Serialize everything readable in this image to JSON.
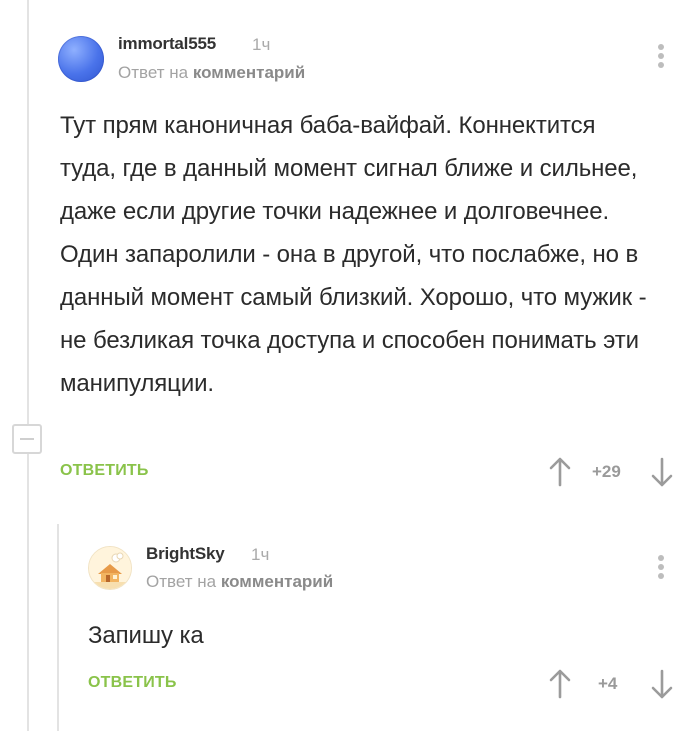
{
  "comments": [
    {
      "username": "immortal555",
      "time": "1ч",
      "reply_prefix": "Ответ на",
      "reply_target": "комментарий",
      "text": "Тут прям каноничная баба-вайфай. Коннектится туда, где в данный момент сигнал ближе и сильнее, даже если другие точки надежнее и долговечнее. Один запаролили - она в другой, что послабже, но в данный момент самый близкий. Хорошо, что мужик - не безликая точка доступа и способен понимать эти манипуляции.",
      "reply_label": "ОТВЕТИТЬ",
      "rating": "+29",
      "avatar_icon": "blue-sphere-avatar"
    },
    {
      "username": "BrightSky",
      "time": "1ч",
      "reply_prefix": "Ответ на",
      "reply_target": "комментарий",
      "text": "Запишу ка",
      "reply_label": "ОТВЕТИТЬ",
      "rating": "+4",
      "avatar_icon": "house-avatar"
    }
  ],
  "colors": {
    "accent_green": "#8ac34a",
    "thread_line": "#e3e3e3",
    "muted_text": "#a3a3a3"
  },
  "icons": [
    "more-vertical-icon",
    "upvote-arrow-icon",
    "downvote-arrow-icon",
    "collapse-thread-icon"
  ]
}
